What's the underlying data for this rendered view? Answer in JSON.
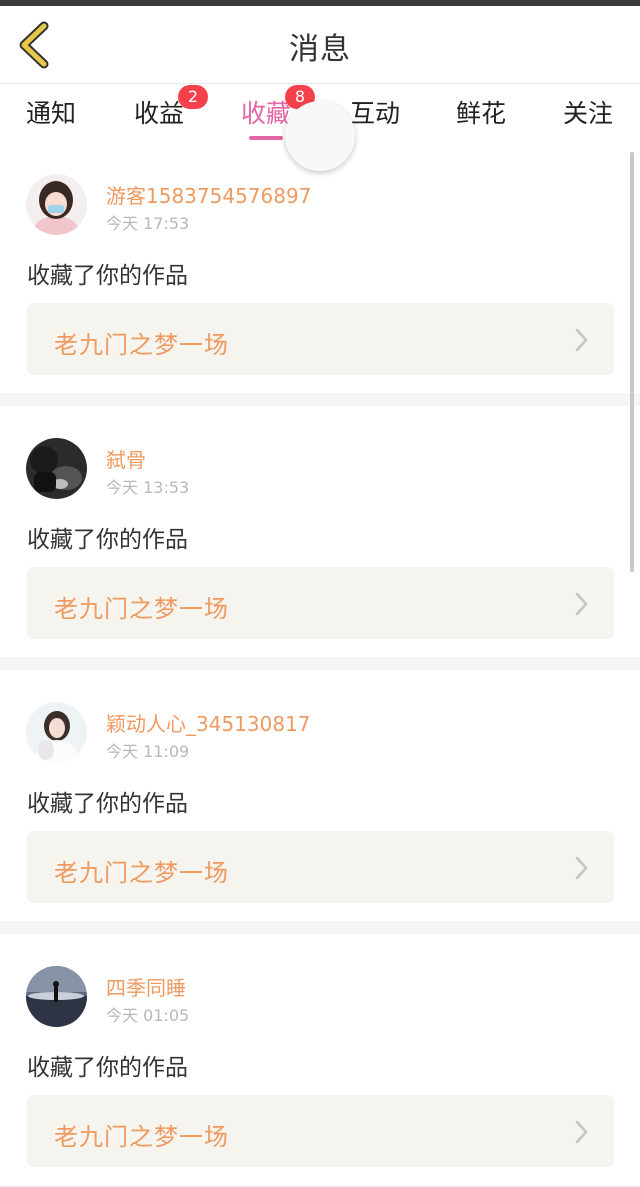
{
  "header": {
    "title": "消息",
    "back_icon": "chevron-left-icon"
  },
  "tabs": [
    {
      "label": "通知",
      "badge": ""
    },
    {
      "label": "收益",
      "badge": "2"
    },
    {
      "label": "收藏",
      "badge": "8"
    },
    {
      "label": "互动",
      "badge": ""
    },
    {
      "label": "鲜花",
      "badge": ""
    },
    {
      "label": "关注",
      "badge": ""
    }
  ],
  "active_tab": "收藏",
  "colors": {
    "accent": "#e466a4",
    "badge": "#f5414b",
    "username": "#ef9a61",
    "back_icon": "#e8c84a"
  },
  "items": [
    {
      "username": "游客1583754576897",
      "time": "今天 17:53",
      "action": "收藏了你的作品",
      "work_title": "老九门之梦一场"
    },
    {
      "username": "弑骨",
      "time": "今天 13:53",
      "action": "收藏了你的作品",
      "work_title": "老九门之梦一场"
    },
    {
      "username": "颖动人心_345130817",
      "time": "今天 11:09",
      "action": "收藏了你的作品",
      "work_title": "老九门之梦一场"
    },
    {
      "username": "四季同睡",
      "time": "今天 01:05",
      "action": "收藏了你的作品",
      "work_title": "老九门之梦一场"
    }
  ]
}
